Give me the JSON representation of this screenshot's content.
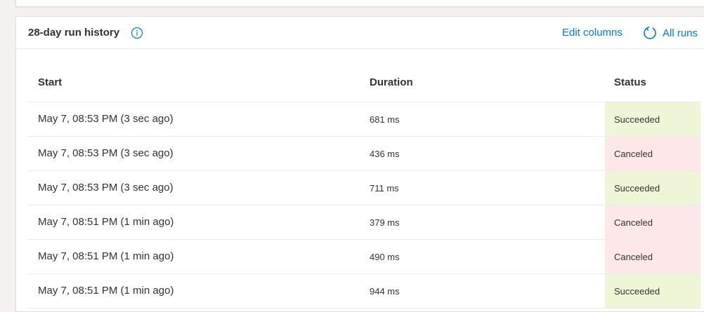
{
  "card": {
    "title": "28-day run history",
    "info_icon": "info-icon",
    "edit_columns_label": "Edit columns",
    "all_runs_label": "All runs",
    "refresh_icon": "refresh-icon"
  },
  "colors": {
    "link": "#0078d4",
    "succeeded_bg": "#eff6d8",
    "canceled_bg": "#fde7e9"
  },
  "table": {
    "columns": [
      "Start",
      "Duration",
      "Status"
    ],
    "rows": [
      {
        "start": "May 7, 08:53 PM (3 sec ago)",
        "duration": "681 ms",
        "status": "Succeeded"
      },
      {
        "start": "May 7, 08:53 PM (3 sec ago)",
        "duration": "436 ms",
        "status": "Canceled"
      },
      {
        "start": "May 7, 08:53 PM (3 sec ago)",
        "duration": "711 ms",
        "status": "Succeeded"
      },
      {
        "start": "May 7, 08:51 PM (1 min ago)",
        "duration": "379 ms",
        "status": "Canceled"
      },
      {
        "start": "May 7, 08:51 PM (1 min ago)",
        "duration": "490 ms",
        "status": "Canceled"
      },
      {
        "start": "May 7, 08:51 PM (1 min ago)",
        "duration": "944 ms",
        "status": "Succeeded"
      }
    ]
  }
}
